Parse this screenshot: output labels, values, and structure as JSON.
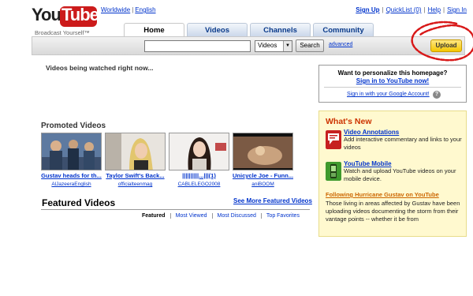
{
  "logo": {
    "you": "You",
    "tube": "Tube",
    "tagline": "Broadcast Yourself™"
  },
  "locale": {
    "region": "Worldwide",
    "language": "English"
  },
  "header_links": {
    "sign_up": "Sign Up",
    "quicklist": "QuickList (0)",
    "help": "Help",
    "sign_in": "Sign In"
  },
  "tabs": [
    {
      "label": "Home",
      "active": true
    },
    {
      "label": "Videos",
      "active": false
    },
    {
      "label": "Channels",
      "active": false
    },
    {
      "label": "Community",
      "active": false
    }
  ],
  "search": {
    "query": "",
    "category": "Videos",
    "button": "Search",
    "advanced": "advanced",
    "upload": "Upload"
  },
  "watched_heading": "Videos being watched right now...",
  "promoted": {
    "title": "Promoted Videos",
    "items": [
      {
        "title": "Gustav heads for th...",
        "user": "AlJazeeraEnglish"
      },
      {
        "title": "Taylor Swift's Back...",
        "user": "officialteenmag"
      },
      {
        "title": "||||||||||...|||(1)",
        "user": "CABLELEGO2008"
      },
      {
        "title": "Unicycle Joe - Funn...",
        "user": "aniBOOM"
      }
    ]
  },
  "featured": {
    "title": "Featured Videos",
    "see_more": "See More Featured Videos",
    "tabs": [
      {
        "label": "Featured",
        "active": true
      },
      {
        "label": "Most Viewed",
        "active": false
      },
      {
        "label": "Most Discussed",
        "active": false
      },
      {
        "label": "Top Favorites",
        "active": false
      }
    ]
  },
  "personalize": {
    "title": "Want to personalize this homepage?",
    "sign_in": "Sign in to YouTube now!",
    "google": "Sign in with your Google Account!",
    "help_glyph": "?"
  },
  "whats_new": {
    "title": "What's New",
    "items": [
      {
        "heading": "Video Annotations",
        "desc": "Add interactive commentary and links to your videos",
        "icon": "video-annotations-icon"
      },
      {
        "heading": "YouTube Mobile",
        "desc": "Watch and upload YouTube videos on your mobile device.",
        "icon": "mobile-phone-icon"
      }
    ],
    "news_heading": "Following Hurricane Gustav on YouTube",
    "news_desc": "Those living in areas affected by Gustav have been uploading videos documenting the storm from their vantage points -- whether it be from"
  },
  "colors": {
    "logo_red": "#cc1b1b",
    "link_blue": "#0033cc",
    "upload_yellow": "#f5c700",
    "whats_new_bg": "#fff9cf",
    "whats_new_title": "#cc3300",
    "annotation_circle": "#d81818"
  }
}
